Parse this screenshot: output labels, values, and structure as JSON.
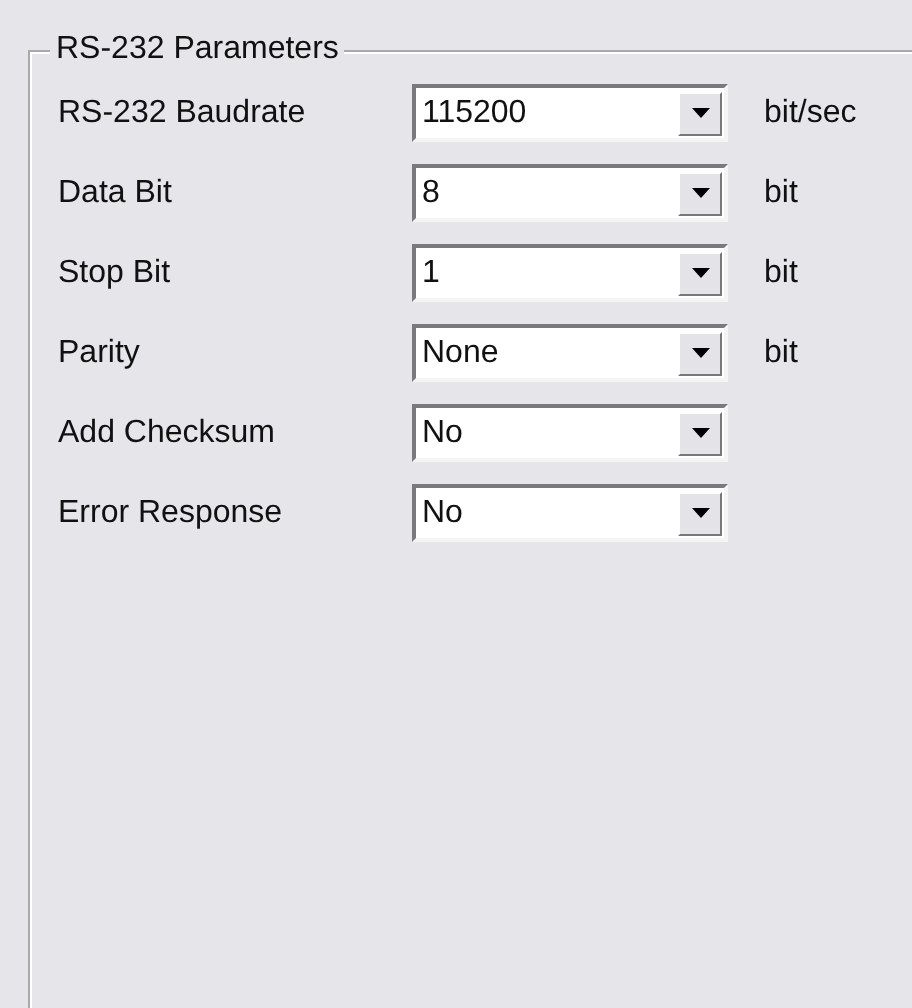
{
  "group": {
    "title": "RS-232  Parameters"
  },
  "rows": [
    {
      "label": "RS-232 Baudrate",
      "value": "115200",
      "unit": "bit/sec"
    },
    {
      "label": "Data Bit",
      "value": "8",
      "unit": "bit"
    },
    {
      "label": "Stop Bit",
      "value": "1",
      "unit": "bit"
    },
    {
      "label": "Parity",
      "value": "None",
      "unit": "bit"
    },
    {
      "label": "Add Checksum",
      "value": "No"
    },
    {
      "label": "Error Response",
      "value": "No"
    }
  ]
}
